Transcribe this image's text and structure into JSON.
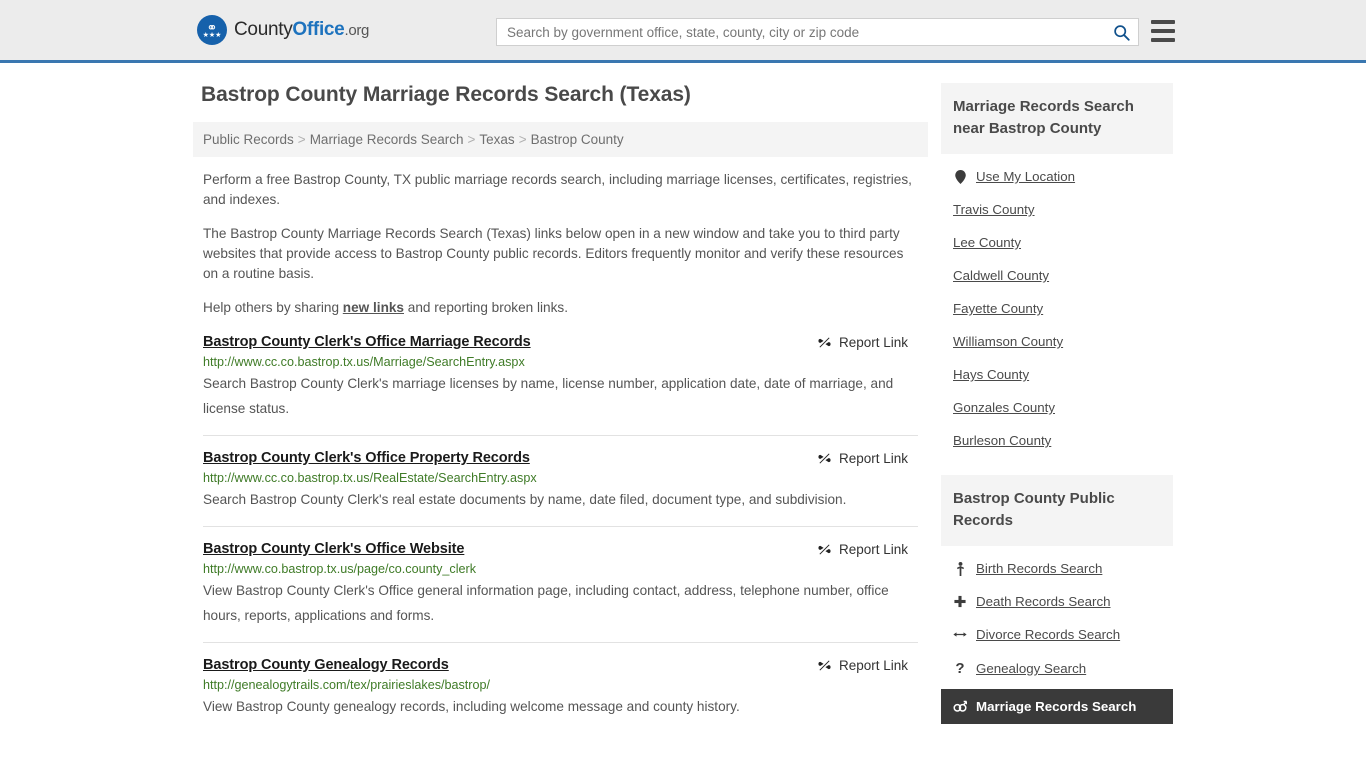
{
  "header": {
    "logo": {
      "text_1": "County",
      "text_2": "Office",
      "text_3": ".org",
      "icon": "eagle-seal-icon"
    },
    "search": {
      "placeholder": "Search by government office, state, county, city or zip code",
      "value": "",
      "icon": "search-icon"
    },
    "menu_icon": "hamburger-menu-icon",
    "accent_color": "#3a77b0"
  },
  "page_title": "Bastrop County Marriage Records Search (Texas)",
  "breadcrumb": {
    "items": [
      "Public Records",
      "Marriage Records Search",
      "Texas",
      "Bastrop County"
    ],
    "separator": ">"
  },
  "intro": {
    "p1": "Perform a free Bastrop County, TX public marriage records search, including marriage licenses, certificates, registries, and indexes.",
    "p2": "The Bastrop County Marriage Records Search (Texas) links below open in a new window and take you to third party websites that provide access to Bastrop County public records. Editors frequently monitor and verify these resources on a routine basis.",
    "p3_before": "Help others by sharing ",
    "p3_link": "new links",
    "p3_after": " and reporting broken links."
  },
  "results": {
    "report_label": "Report Link",
    "report_icon": "broken-link-icon",
    "items": [
      {
        "title": "Bastrop County Clerk's Office Marriage Records",
        "url": "http://www.cc.co.bastrop.tx.us/Marriage/SearchEntry.aspx",
        "description": "Search Bastrop County Clerk's marriage licenses by name, license number, application date, date of marriage, and license status."
      },
      {
        "title": "Bastrop County Clerk's Office Property Records",
        "url": "http://www.cc.co.bastrop.tx.us/RealEstate/SearchEntry.aspx",
        "description": "Search Bastrop County Clerk's real estate documents by name, date filed, document type, and subdivision."
      },
      {
        "title": "Bastrop County Clerk's Office Website",
        "url": "http://www.co.bastrop.tx.us/page/co.county_clerk",
        "description": "View Bastrop County Clerk's Office general information page, including contact, address, telephone number, office hours, reports, applications and forms."
      },
      {
        "title": "Bastrop County Genealogy Records",
        "url": "http://genealogytrails.com/tex/prairieslakes/bastrop/",
        "description": "View Bastrop County genealogy records, including welcome message and county history."
      }
    ]
  },
  "sidebar": {
    "nearby": {
      "heading": "Marriage Records Search near Bastrop County",
      "items": [
        {
          "label": "Use My Location",
          "icon": "map-pin-icon"
        },
        {
          "label": "Travis County",
          "icon": ""
        },
        {
          "label": "Lee County",
          "icon": ""
        },
        {
          "label": "Caldwell County",
          "icon": ""
        },
        {
          "label": "Fayette County",
          "icon": ""
        },
        {
          "label": "Williamson County",
          "icon": ""
        },
        {
          "label": "Hays County",
          "icon": ""
        },
        {
          "label": "Gonzales County",
          "icon": ""
        },
        {
          "label": "Burleson County",
          "icon": ""
        }
      ]
    },
    "public_records": {
      "heading": "Bastrop County Public Records",
      "items": [
        {
          "label": "Birth Records Search",
          "icon": "baby-icon",
          "glyph": "ف",
          "active": false
        },
        {
          "label": "Death Records Search",
          "icon": "cross-icon",
          "glyph": "✚",
          "active": false
        },
        {
          "label": "Divorce Records Search",
          "icon": "split-arrows-icon",
          "glyph": "↔",
          "active": false
        },
        {
          "label": "Genealogy Search",
          "icon": "question-mark-icon",
          "glyph": "?",
          "active": false
        },
        {
          "label": "Marriage Records Search",
          "icon": "male-female-icon",
          "glyph": "⚥",
          "active": true
        }
      ]
    }
  }
}
